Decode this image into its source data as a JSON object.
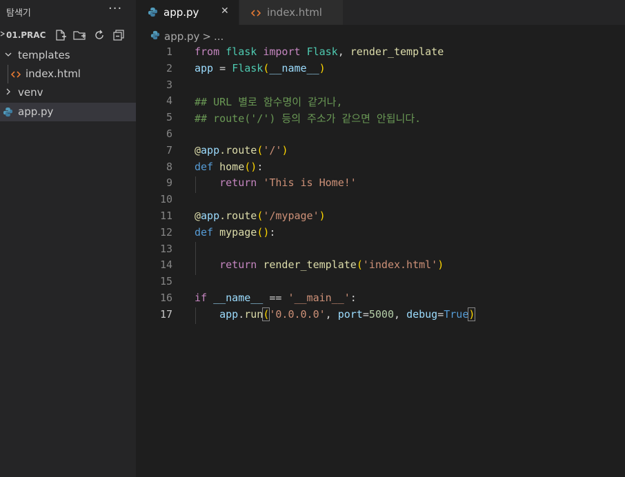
{
  "sidebar": {
    "title": "탐색기",
    "more": "···",
    "project": "01.PRAC",
    "items": [
      {
        "label": "templates",
        "expanded": true
      },
      {
        "label": "index.html"
      },
      {
        "label": "venv",
        "expanded": false
      },
      {
        "label": "app.py",
        "selected": true
      }
    ]
  },
  "tabs": [
    {
      "label": "app.py",
      "active": true,
      "close": "✕"
    },
    {
      "label": "index.html",
      "active": false
    }
  ],
  "breadcrumb": {
    "file": "app.py",
    "sep": ">",
    "rest": "..."
  },
  "editor": {
    "current_line": 17,
    "lines": [
      {
        "n": "1",
        "tokens": [
          [
            "from",
            "kc"
          ],
          [
            " "
          ],
          [
            "flask",
            "t"
          ],
          [
            " "
          ],
          [
            "import",
            "kc"
          ],
          [
            " "
          ],
          [
            "Flask",
            "t"
          ],
          [
            ", "
          ],
          [
            "render_template",
            "f"
          ]
        ]
      },
      {
        "n": "2",
        "tokens": [
          [
            "app",
            "v"
          ],
          [
            " = "
          ],
          [
            "Flask",
            "t"
          ],
          [
            "(",
            "b"
          ],
          [
            "__name__",
            "v"
          ],
          [
            ")",
            "b"
          ]
        ]
      },
      {
        "n": "3",
        "tokens": []
      },
      {
        "n": "4",
        "tokens": [
          [
            "## URL 별로 함수명이 같거나,",
            "c"
          ]
        ]
      },
      {
        "n": "5",
        "tokens": [
          [
            "## route('/') 등의 주소가 같으면 안됩니다.",
            "c"
          ]
        ]
      },
      {
        "n": "6",
        "tokens": []
      },
      {
        "n": "7",
        "tokens": [
          [
            "@",
            "f"
          ],
          [
            "app",
            "v"
          ],
          [
            ".",
            "f"
          ],
          [
            "route",
            "f"
          ],
          [
            "(",
            "b"
          ],
          [
            "'/'",
            "s"
          ],
          [
            ")",
            "b"
          ]
        ]
      },
      {
        "n": "8",
        "tokens": [
          [
            "def",
            "k"
          ],
          [
            " "
          ],
          [
            "home",
            "f"
          ],
          [
            "(",
            "b"
          ],
          [
            ")",
            "b"
          ],
          [
            ":"
          ]
        ]
      },
      {
        "n": "9",
        "tokens": [
          [
            "    "
          ],
          [
            "return",
            "kc"
          ],
          [
            " "
          ],
          [
            "'This is Home!'",
            "s"
          ]
        ]
      },
      {
        "n": "10",
        "tokens": []
      },
      {
        "n": "11",
        "tokens": [
          [
            "@",
            "f"
          ],
          [
            "app",
            "v"
          ],
          [
            ".",
            "f"
          ],
          [
            "route",
            "f"
          ],
          [
            "(",
            "b"
          ],
          [
            "'/mypage'",
            "s"
          ],
          [
            ")",
            "b"
          ]
        ]
      },
      {
        "n": "12",
        "tokens": [
          [
            "def",
            "k"
          ],
          [
            " "
          ],
          [
            "mypage",
            "f"
          ],
          [
            "(",
            "b"
          ],
          [
            ")",
            "b"
          ],
          [
            ":"
          ]
        ]
      },
      {
        "n": "13",
        "tokens": []
      },
      {
        "n": "14",
        "tokens": [
          [
            "    "
          ],
          [
            "return",
            "kc"
          ],
          [
            " "
          ],
          [
            "render_template",
            "f"
          ],
          [
            "(",
            "b"
          ],
          [
            "'index.html'",
            "s"
          ],
          [
            ")",
            "b"
          ]
        ]
      },
      {
        "n": "15",
        "tokens": []
      },
      {
        "n": "16",
        "tokens": [
          [
            "if",
            "kc"
          ],
          [
            " "
          ],
          [
            "__name__",
            "v"
          ],
          [
            " == "
          ],
          [
            "'__main__'",
            "s"
          ],
          [
            ":"
          ]
        ]
      },
      {
        "n": "17",
        "tokens": [
          [
            "    "
          ],
          [
            "app",
            "v"
          ],
          [
            "."
          ],
          [
            "run",
            "f"
          ],
          [
            "(",
            "bm"
          ],
          [
            "'0.0.0.0'",
            "s"
          ],
          [
            ", "
          ],
          [
            "port",
            "v"
          ],
          [
            "="
          ],
          [
            "5000",
            "n"
          ],
          [
            ", "
          ],
          [
            "debug",
            "v"
          ],
          [
            "="
          ],
          [
            "True",
            "k"
          ],
          [
            ")",
            "bm"
          ]
        ]
      }
    ]
  },
  "colors": {
    "background": "#1e1e1e",
    "sidebar": "#252526",
    "keyword": "#569cd6",
    "control": "#c586c0",
    "string": "#ce9178",
    "comment": "#6a9955",
    "function": "#dcdcaa",
    "variable": "#9cdcfe",
    "class": "#4ec9b0",
    "number": "#b5cea8",
    "bracket": "#ffd700"
  }
}
